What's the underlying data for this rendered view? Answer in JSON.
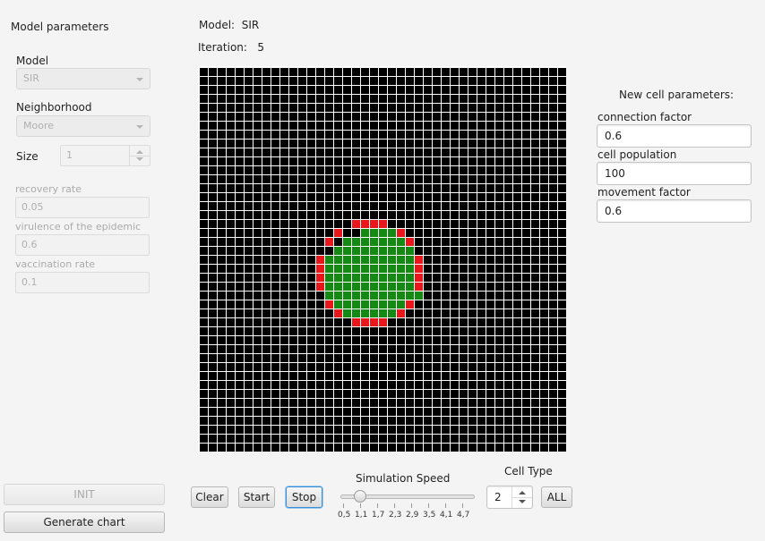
{
  "left_panel": {
    "title": "Model parameters",
    "model_label": "Model",
    "model_value": "SIR",
    "neighborhood_label": "Neighborhood",
    "neighborhood_value": "Moore",
    "size_label": "Size",
    "size_value": "1",
    "recovery_label": "recovery rate",
    "recovery_value": "0.05",
    "virulence_label": "virulence of the epidemic",
    "virulence_value": "0.6",
    "vaccination_label": "vaccination rate",
    "vaccination_value": "0.1",
    "init_button": "INIT",
    "chart_button": "Generate chart"
  },
  "header": {
    "model_label": "Model:",
    "model_value": "SIR",
    "iteration_label": "Iteration:",
    "iteration_value": "5"
  },
  "grid": {
    "rows": 43,
    "cols": 41,
    "colors": {
      "empty": "#000000",
      "infected": "#e8171b",
      "recovered": "#148a14",
      "gap": "#ffffff"
    },
    "recovered_rows": [
      [
        18,
        18,
        21
      ],
      [
        19,
        16,
        23
      ],
      [
        20,
        15,
        23
      ],
      [
        21,
        14,
        24
      ],
      [
        22,
        14,
        24
      ],
      [
        23,
        14,
        24
      ],
      [
        24,
        14,
        24
      ],
      [
        25,
        14,
        24
      ],
      [
        26,
        15,
        23
      ],
      [
        27,
        16,
        22
      ]
    ],
    "infected_cells": [
      [
        17,
        17
      ],
      [
        17,
        18
      ],
      [
        17,
        19
      ],
      [
        17,
        20
      ],
      [
        18,
        15
      ],
      [
        18,
        22
      ],
      [
        19,
        14
      ],
      [
        19,
        23
      ],
      [
        21,
        13
      ],
      [
        21,
        24
      ],
      [
        22,
        13
      ],
      [
        22,
        24
      ],
      [
        23,
        13
      ],
      [
        23,
        24
      ],
      [
        24,
        13
      ],
      [
        24,
        24
      ],
      [
        26,
        14
      ],
      [
        26,
        23
      ],
      [
        27,
        15
      ],
      [
        27,
        22
      ],
      [
        28,
        17
      ],
      [
        28,
        18
      ],
      [
        28,
        19
      ],
      [
        28,
        20
      ]
    ]
  },
  "controls": {
    "clear_button": "Clear",
    "start_button": "Start",
    "stop_button": "Stop",
    "speed_label": "Simulation Speed",
    "speed_ticks": [
      "0,5",
      "1,1",
      "1,7",
      "2,3",
      "2,9",
      "3,5",
      "4,1",
      "4,7"
    ],
    "speed_min": 0.5,
    "speed_max": 5.0,
    "speed_value": 1.1,
    "cell_type_label": "Cell Type",
    "cell_type_value": "2",
    "all_button": "ALL"
  },
  "right_panel": {
    "title": "New cell parameters:",
    "connection_label": "connection factor",
    "connection_value": "0.6",
    "population_label": "cell population",
    "population_value": "100",
    "movement_label": "movement factor",
    "movement_value": "0.6"
  }
}
